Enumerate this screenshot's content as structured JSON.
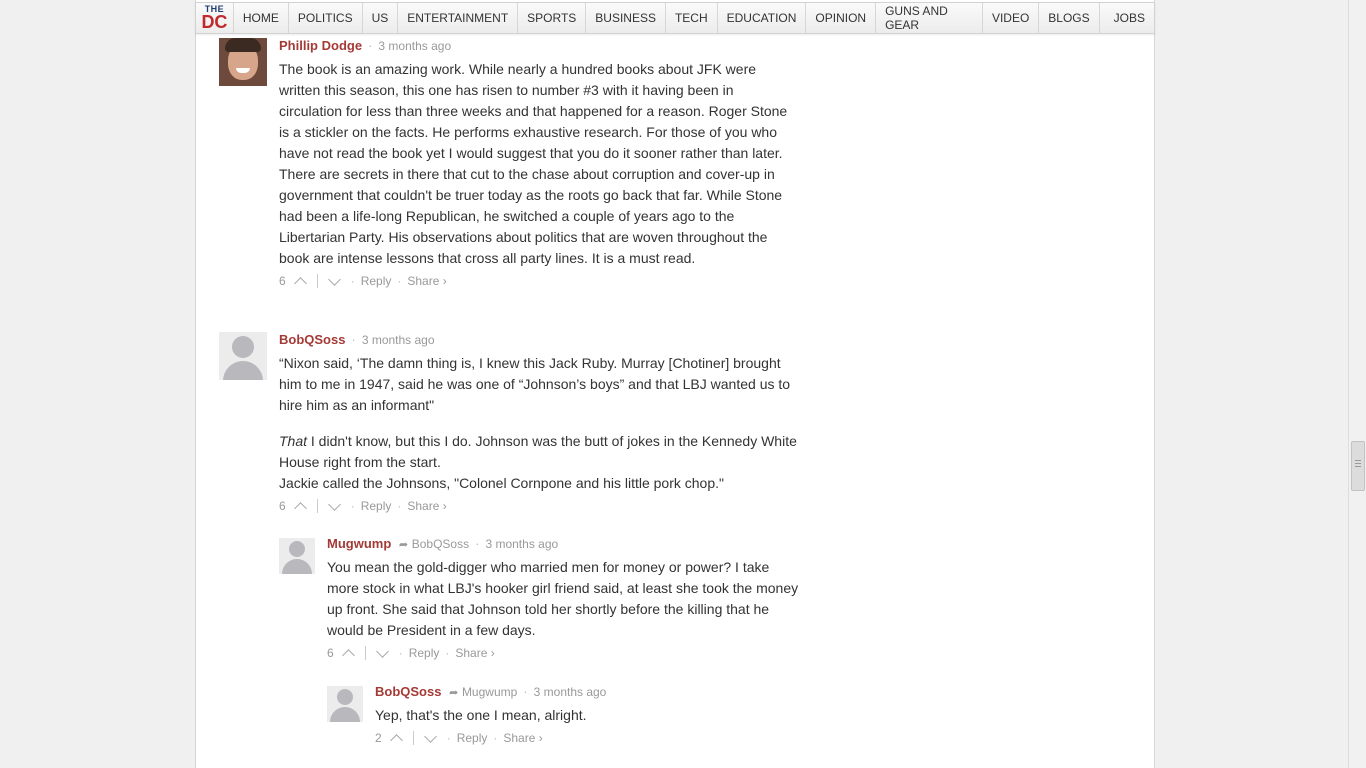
{
  "nav": {
    "logo_top": "THE",
    "logo_bottom": "DC",
    "items": [
      "HOME",
      "POLITICS",
      "US",
      "ENTERTAINMENT",
      "SPORTS",
      "BUSINESS",
      "TECH",
      "EDUCATION",
      "OPINION",
      "GUNS AND GEAR",
      "VIDEO",
      "BLOGS",
      "JOBS"
    ]
  },
  "comments": [
    {
      "author": "Phillip Dodge",
      "time": "3 months ago",
      "paragraphs": [
        "The book is an amazing work. While nearly a hundred books about JFK were written this season, this one has risen to number #3 with it having been in circulation for less than three weeks and that happened for a reason. Roger Stone is a stickler on the facts. He performs exhaustive research. For those of you who have not read the book yet I would suggest that you do it sooner rather than later. There are secrets in there that cut to the chase about corruption and cover-up in government that couldn't be truer today as the roots go back that far. While Stone had been a life-long Republican, he switched a couple of years ago to the Libertarian Party. His observations about politics that are woven throughout the book are intense lessons that cross all party lines. It is a must read."
      ],
      "votes": "6",
      "reply": "Reply",
      "share": "Share ›"
    },
    {
      "author": "BobQSoss",
      "time": "3 months ago",
      "p1": "“Nixon said, ‘The damn thing is, I knew this Jack Ruby. Murray [Chotiner] brought him to me in 1947, said he was one of “Johnson’s boys” and that LBJ wanted us to hire him as an informant\"",
      "p2_em": "That",
      "p2_rest": " I didn't know, but this I do. Johnson was the butt of jokes in the Kennedy White House right from the start.",
      "p3": "Jackie called the Johnsons, \"Colonel Cornpone and his little pork chop.\"",
      "votes": "6",
      "reply": "Reply",
      "share": "Share ›"
    },
    {
      "author": "Mugwump",
      "reply_to": "BobQSoss",
      "time": "3 months ago",
      "text": "You mean the gold-digger who married men for money or power? I take more stock in what LBJ's hooker girl friend said, at least she took the money up front. She said that Johnson told her shortly before the killing that he would be President in a few days.",
      "votes": "6",
      "reply": "Reply",
      "share": "Share ›"
    },
    {
      "author": "BobQSoss",
      "reply_to": "Mugwump",
      "time": "3 months ago",
      "text": "Yep, that's the one I mean, alright.",
      "votes": "2",
      "reply": "Reply",
      "share": "Share ›"
    }
  ]
}
